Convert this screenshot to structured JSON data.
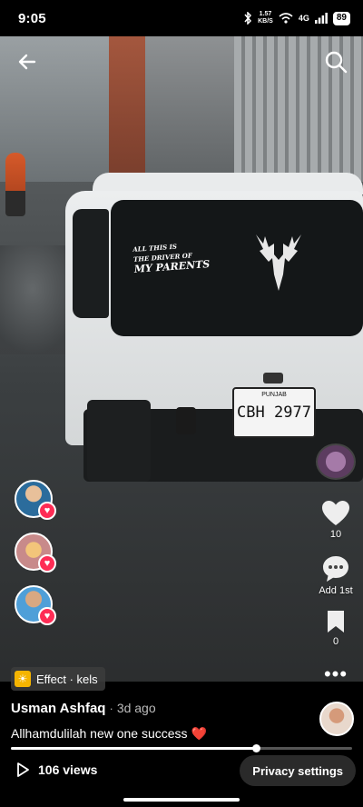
{
  "status_bar": {
    "time": "9:05",
    "network_speed_value": "1.57",
    "network_speed_unit": "KB/S",
    "network_type": "4G",
    "battery": "89",
    "icons": [
      "bluetooth-icon",
      "wifi-icon",
      "signal-icon",
      "battery-icon"
    ]
  },
  "top_bar": {
    "back_icon": "arrow-left-icon",
    "search_icon": "search-icon"
  },
  "video": {
    "sticker_lines": [
      "ALL THIS IS",
      "THE DRIVER OF",
      "MY PARENTS"
    ],
    "plate_header": "PUNJAB",
    "plate_number": "CBH 2977"
  },
  "likers": [
    {
      "name": "liker-avatar-1"
    },
    {
      "name": "liker-avatar-2"
    },
    {
      "name": "liker-avatar-3"
    }
  ],
  "actions": {
    "like_count": "10",
    "comment_label": "Add 1st",
    "save_count": "0",
    "more": "•••"
  },
  "effect": {
    "label": "Effect · kels"
  },
  "post": {
    "username": "Usman Ashfaq",
    "separator": "·",
    "posted": "3d ago",
    "caption": "Allhamdulilah new one success",
    "caption_emoji": "❤️"
  },
  "progress": {
    "value": 0.717
  },
  "footer": {
    "views": "106 views",
    "privacy_button": "Privacy settings"
  },
  "colors": {
    "accent_heart": "#fe2c55",
    "effect_icon": "#f5b400"
  }
}
